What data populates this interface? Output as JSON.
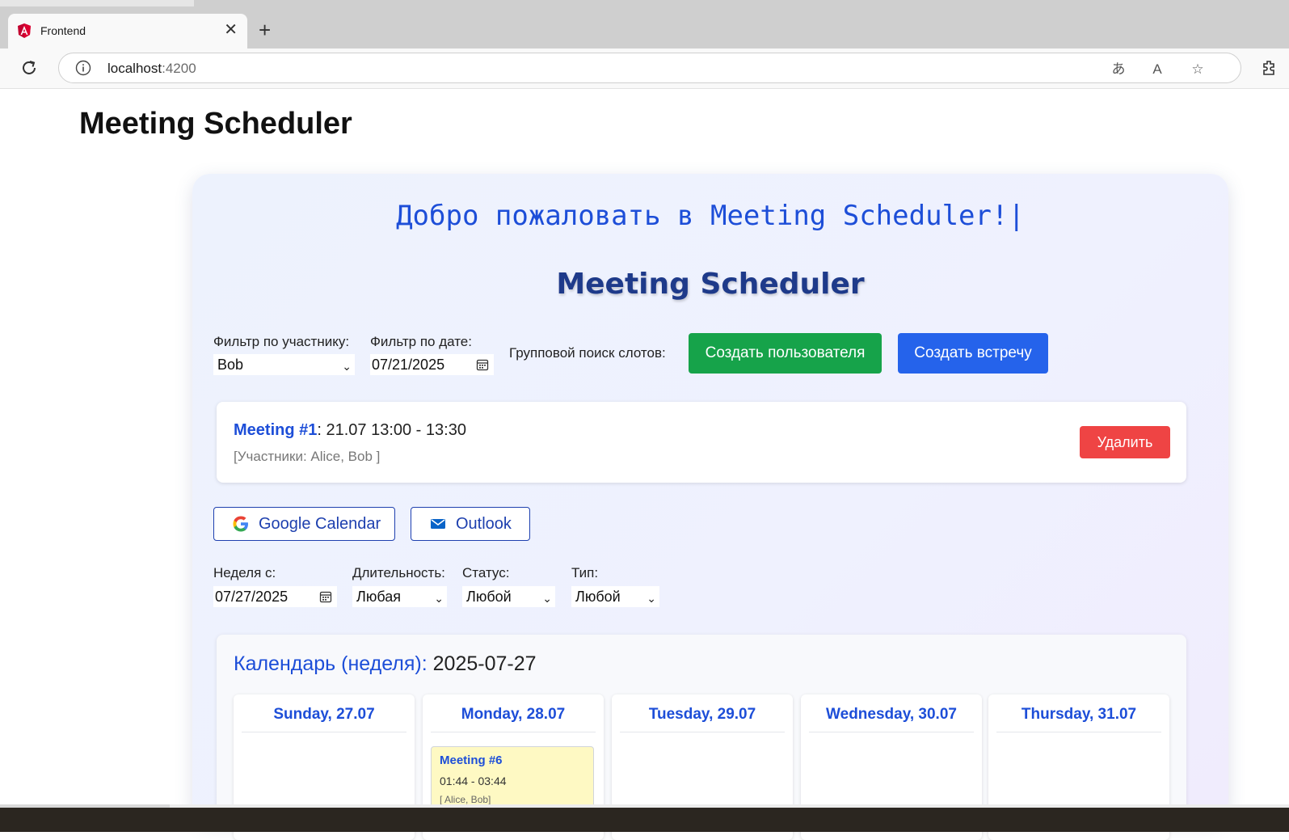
{
  "browser": {
    "tab_title": "Frontend",
    "url_host": "localhost",
    "url_port": ":4200"
  },
  "page": {
    "heading": "Meeting Scheduler"
  },
  "card": {
    "welcome": "Добро пожаловать в Meeting Scheduler!",
    "cursor": "|",
    "title": "Meeting Scheduler"
  },
  "filters": {
    "participant_label": "Фильтр по участнику:",
    "participant_value": "Bob",
    "date_label": "Фильтр по дате:",
    "date_value": "07/21/2025",
    "group_search_label": "Групповой поиск слотов:",
    "create_user": "Создать пользователя",
    "create_meeting": "Создать встречу"
  },
  "meeting": {
    "name": "Meeting #1",
    "time": ": 21.07 13:00 - 13:30",
    "participants": "[Участники: Alice, Bob ]",
    "delete": "Удалить"
  },
  "export": {
    "google": "Google Calendar",
    "outlook": "Outlook"
  },
  "week_filters": {
    "week_label": "Неделя с:",
    "week_value": "07/27/2025",
    "duration_label": "Длительность:",
    "duration_value": "Любая",
    "status_label": "Статус:",
    "status_value": "Любой",
    "type_label": "Тип:",
    "type_value": "Любой"
  },
  "calendar": {
    "title_label": "Календарь (неделя):",
    "title_date": " 2025-07-27",
    "days": [
      {
        "label": "Sunday, 27.07"
      },
      {
        "label": "Monday, 28.07"
      },
      {
        "label": "Tuesday, 29.07"
      },
      {
        "label": "Wednesday, 30.07"
      },
      {
        "label": "Thursday, 31.07"
      }
    ],
    "event": {
      "title": "Meeting #6",
      "time": "01:44 - 03:44",
      "participants": "[ Alice, Bob]"
    }
  },
  "colors": {
    "primary": "#1d4ed8",
    "green": "#16a34a",
    "blue": "#2563eb",
    "red": "#ef4444",
    "event_bg": "#fef9c3"
  }
}
